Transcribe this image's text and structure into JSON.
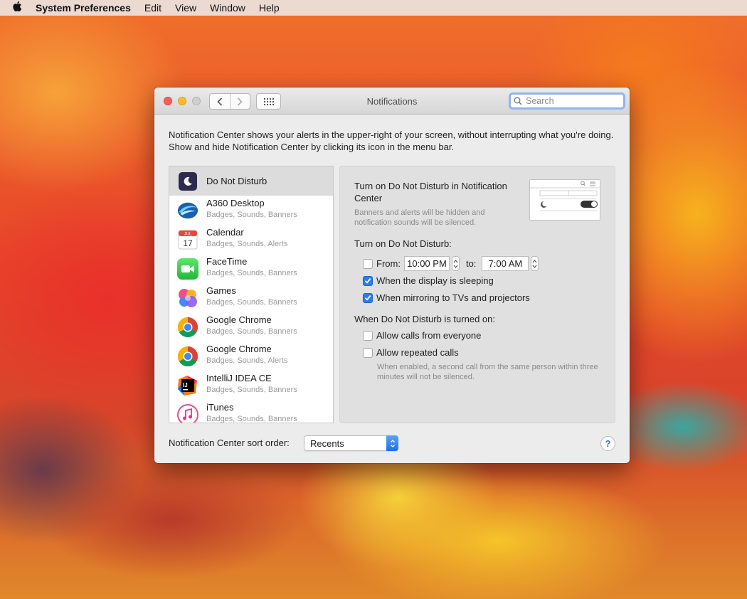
{
  "menubar": {
    "app_name": "System Preferences",
    "items": [
      "Edit",
      "View",
      "Window",
      "Help"
    ]
  },
  "window": {
    "title": "Notifications",
    "search_placeholder": "Search",
    "description": "Notification Center shows your alerts in the upper-right of your screen, without interrupting what you're doing. Show and hide Notification Center by clicking its icon in the menu bar."
  },
  "apps": [
    {
      "name": "Do Not Disturb",
      "subtitle": "",
      "icon": "moon-icon",
      "selected": true
    },
    {
      "name": "A360 Desktop",
      "subtitle": "Badges, Sounds, Banners",
      "icon": "a360-icon"
    },
    {
      "name": "Calendar",
      "subtitle": "Badges, Sounds, Alerts",
      "icon": "calendar-icon"
    },
    {
      "name": "FaceTime",
      "subtitle": "Badges, Sounds, Banners",
      "icon": "facetime-icon"
    },
    {
      "name": "Games",
      "subtitle": "Badges, Sounds, Banners",
      "icon": "games-icon"
    },
    {
      "name": "Google Chrome",
      "subtitle": "Badges, Sounds, Banners",
      "icon": "chrome-icon"
    },
    {
      "name": "Google Chrome",
      "subtitle": "Badges, Sounds, Alerts",
      "icon": "chrome-icon"
    },
    {
      "name": "IntelliJ IDEA CE",
      "subtitle": "Badges, Sounds, Banners",
      "icon": "intellij-icon"
    },
    {
      "name": "iTunes",
      "subtitle": "Badges, Sounds, Banners",
      "icon": "itunes-icon"
    }
  ],
  "calendar_icon": {
    "month": "JUL",
    "day": "17"
  },
  "intellij_icon": {
    "letters": "IJ"
  },
  "dnd": {
    "title": "Turn on Do Not Disturb in Notification Center",
    "note": "Banners and alerts will be hidden and notification sounds will be silenced.",
    "turn_on_label": "Turn on Do Not Disturb:",
    "from_label": "From:",
    "from_value": "10:00 PM",
    "to_label": "to:",
    "to_value": "7:00 AM",
    "from_checked": false,
    "display_sleeping_label": "When the display is sleeping",
    "display_sleeping_checked": true,
    "mirroring_label": "When mirroring to TVs and projectors",
    "mirroring_checked": true,
    "when_on_label": "When Do Not Disturb is turned on:",
    "calls_everyone_label": "Allow calls from everyone",
    "calls_everyone_checked": false,
    "repeated_calls_label": "Allow repeated calls",
    "repeated_calls_checked": false,
    "repeated_hint": "When enabled, a second call from the same person within three minutes will not be silenced."
  },
  "sort": {
    "label": "Notification Center sort order:",
    "value": "Recents"
  },
  "help_label": "?",
  "colors": {
    "accent": "#2b7bf2",
    "close": "#fd5d57",
    "minimize": "#fdbc2e"
  }
}
